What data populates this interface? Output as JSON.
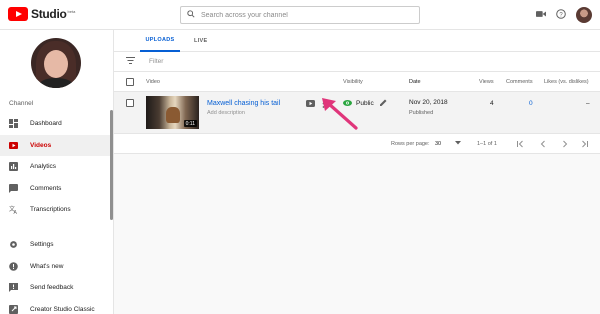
{
  "app": {
    "logo_text": "Studio",
    "logo_badge": "beta"
  },
  "search": {
    "placeholder": "Search across your channel"
  },
  "header_icons": [
    "create-video-icon",
    "help-icon",
    "account-avatar"
  ],
  "sidebar": {
    "section_label": "Channel",
    "items": [
      {
        "label": "Dashboard",
        "icon": "dashboard-icon",
        "active": false
      },
      {
        "label": "Videos",
        "icon": "videos-icon",
        "active": true
      },
      {
        "label": "Analytics",
        "icon": "analytics-icon",
        "active": false
      },
      {
        "label": "Comments",
        "icon": "comments-icon",
        "active": false
      },
      {
        "label": "Transcriptions",
        "icon": "transcriptions-icon",
        "active": false
      }
    ],
    "bottom_items": [
      {
        "label": "Settings",
        "icon": "settings-icon"
      },
      {
        "label": "What's new",
        "icon": "whats-new-icon"
      },
      {
        "label": "Send feedback",
        "icon": "feedback-icon"
      },
      {
        "label": "Creator Studio Classic",
        "icon": "creator-studio-classic-icon"
      }
    ]
  },
  "tabs": [
    {
      "label": "UPLOADS",
      "active": true
    },
    {
      "label": "LIVE",
      "active": false
    }
  ],
  "filter": {
    "placeholder": "Filter"
  },
  "table": {
    "headers": {
      "video": "Video",
      "visibility": "Visibility",
      "date": "Date",
      "views": "Views",
      "comments": "Comments",
      "likes": "Likes (vs. dislikes)"
    },
    "rows": [
      {
        "title": "Maxwell chasing his tail",
        "description": "Add description",
        "duration": "0:11",
        "visibility": "Public",
        "date": "Nov 20, 2018",
        "status": "Published",
        "views": "4",
        "comments": "0",
        "likes": "–"
      }
    ]
  },
  "pagination": {
    "rows_per_page_label": "Rows per page:",
    "rows_per_page": "30",
    "range": "1–1 of 1"
  },
  "colors": {
    "accent": "#065fd4",
    "brand_red": "#ff0000",
    "active_nav": "#cc0000",
    "visibility_green": "#2ba640",
    "annotation_arrow": "#e0357a"
  }
}
